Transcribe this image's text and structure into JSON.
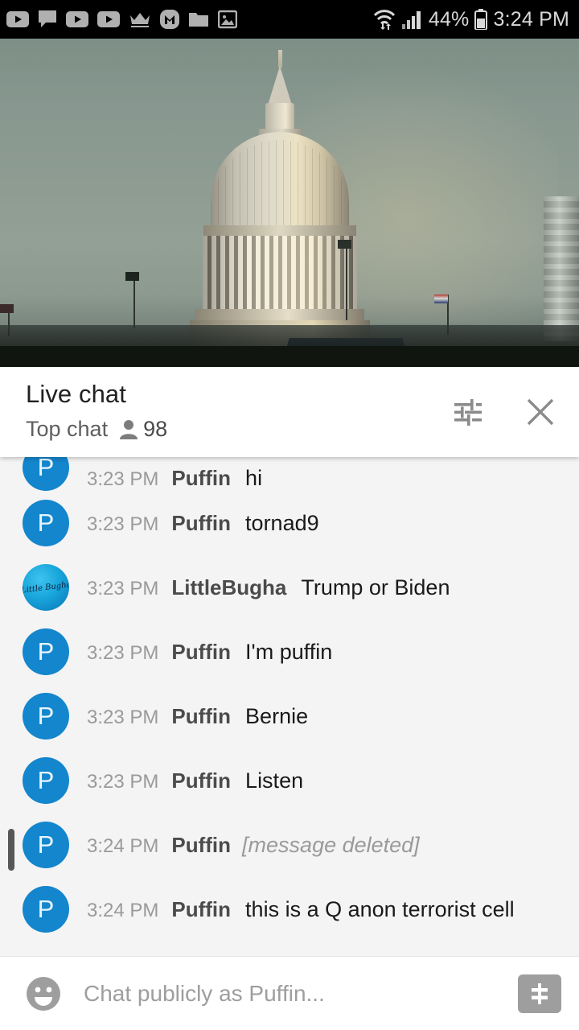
{
  "status_bar": {
    "icons": [
      "youtube-icon",
      "chat-bubble-icon",
      "youtube-icon",
      "youtube-icon",
      "crown-icon",
      "m-logo-icon",
      "folder-icon",
      "image-icon"
    ],
    "wifi_icon": "wifi-transfer-icon",
    "signal_icon": "cellular-signal-icon",
    "battery_percent": "44%",
    "battery_icon": "battery-icon",
    "time": "3:24 PM"
  },
  "video": {
    "name": "live-video-player",
    "scene": "US Capitol dome at sunset",
    "progress_color": "#ff0000"
  },
  "chat_header": {
    "title": "Live chat",
    "mode": "Top chat",
    "viewer_icon": "person-icon",
    "viewer_count": "98",
    "tune_icon": "tune-sliders-icon",
    "close_icon": "close-icon"
  },
  "messages": [
    {
      "avatar_type": "puffin",
      "avatar_letter": "P",
      "time": "3:23 PM",
      "user": "Puffin",
      "text": "hi",
      "deleted": false,
      "clipped": true
    },
    {
      "avatar_type": "puffin",
      "avatar_letter": "P",
      "time": "3:23 PM",
      "user": "Puffin",
      "text": "tornad9",
      "deleted": false,
      "clipped": false
    },
    {
      "avatar_type": "bugha",
      "avatar_letter": "Little Bugha",
      "time": "3:23 PM",
      "user": "LittleBugha",
      "text": "Trump or Biden",
      "deleted": false,
      "clipped": false
    },
    {
      "avatar_type": "puffin",
      "avatar_letter": "P",
      "time": "3:23 PM",
      "user": "Puffin",
      "text": "I'm puffin",
      "deleted": false,
      "clipped": false
    },
    {
      "avatar_type": "puffin",
      "avatar_letter": "P",
      "time": "3:23 PM",
      "user": "Puffin",
      "text": "Bernie",
      "deleted": false,
      "clipped": false
    },
    {
      "avatar_type": "puffin",
      "avatar_letter": "P",
      "time": "3:23 PM",
      "user": "Puffin",
      "text": "Listen",
      "deleted": false,
      "clipped": false
    },
    {
      "avatar_type": "puffin",
      "avatar_letter": "P",
      "time": "3:24 PM",
      "user": "Puffin",
      "text": "[message deleted]",
      "deleted": true,
      "clipped": false
    },
    {
      "avatar_type": "puffin",
      "avatar_letter": "P",
      "time": "3:24 PM",
      "user": "Puffin",
      "text": "this is a Q anon terrorist cell",
      "deleted": false,
      "clipped": false
    }
  ],
  "input_bar": {
    "emoji_icon": "emoji-smiley-icon",
    "placeholder": "Chat publicly as Puffin...",
    "superchat_icon": "dollar-superchat-icon"
  },
  "colors": {
    "accent_red": "#ff0000",
    "avatar_blue": "#1386cd",
    "chat_bg": "#f4f4f4",
    "status_bar_bg": "#000000"
  }
}
